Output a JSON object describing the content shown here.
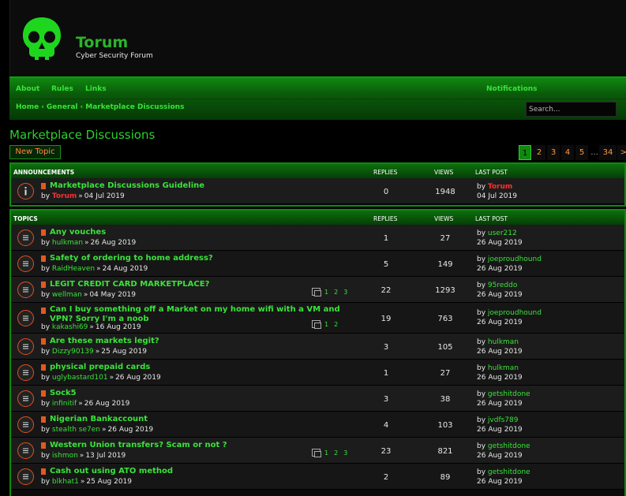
{
  "header": {
    "title": "Torum",
    "subtitle": "Cyber Security Forum"
  },
  "nav": {
    "about": "About",
    "rules": "Rules",
    "links": "Links",
    "notifications": "Notifications"
  },
  "breadcrumbs": [
    "Home",
    "General",
    "Marketplace Discussions"
  ],
  "search": {
    "placeholder": "Search..."
  },
  "page_title": "Marketplace Discussions",
  "new_topic_label": "New Topic",
  "pagination": {
    "pages": [
      "1",
      "2",
      "3",
      "4",
      "5",
      "...",
      "34",
      ">"
    ],
    "current": "1"
  },
  "announcements": {
    "headers": {
      "section": "ANNOUNCEMENTS",
      "replies": "REPLIES",
      "views": "VIEWS",
      "last_post": "LAST POST"
    },
    "rows": [
      {
        "title": "Marketplace Discussions Guideline",
        "by": "by",
        "author": "Torum",
        "date": "04 Jul 2019",
        "replies": "0",
        "views": "1948",
        "last_user": "Torum",
        "last_date": "04 Jul 2019"
      }
    ]
  },
  "topics": {
    "headers": {
      "section": "TOPICS",
      "replies": "REPLIES",
      "views": "VIEWS",
      "last_post": "LAST POST"
    },
    "rows": [
      {
        "title": "Any vouches",
        "author": "hulkman",
        "date": "26 Aug 2019",
        "replies": "1",
        "views": "27",
        "last_user": "user212",
        "last_date": "26 Aug 2019"
      },
      {
        "title": "Safety of ordering to home address?",
        "author": "RaidHeaven",
        "date": "24 Aug 2019",
        "replies": "5",
        "views": "149",
        "last_user": "joeproudhound",
        "last_date": "26 Aug 2019"
      },
      {
        "title": "LEGIT CREDIT CARD MARKETPLACE?",
        "author": "wellman",
        "date": "04 May 2019",
        "replies": "22",
        "views": "1293",
        "last_user": "95reddo",
        "last_date": "26 Aug 2019",
        "pages": [
          "1",
          "2",
          "3"
        ]
      },
      {
        "title": "Can I buy something off a Market on my home wifi with a VM and VPN? Sorry I'm a noob",
        "author": "kakashi69",
        "date": "16 Aug 2019",
        "replies": "19",
        "views": "763",
        "last_user": "joeproudhound",
        "last_date": "26 Aug 2019",
        "pages": [
          "1",
          "2"
        ]
      },
      {
        "title": "Are these markets legit?",
        "author": "Dizzy90139",
        "date": "25 Aug 2019",
        "replies": "3",
        "views": "105",
        "last_user": "hulkman",
        "last_date": "26 Aug 2019"
      },
      {
        "title": "physical prepaid cards",
        "author": "uglybastard101",
        "date": "26 Aug 2019",
        "replies": "1",
        "views": "27",
        "last_user": "hulkman",
        "last_date": "26 Aug 2019"
      },
      {
        "title": "Sock5",
        "author": "infinitif",
        "date": "26 Aug 2019",
        "replies": "3",
        "views": "38",
        "last_user": "getshitdone",
        "last_date": "26 Aug 2019"
      },
      {
        "title": "Nigerian Bankaccount",
        "author": "stealth se7en",
        "date": "26 Aug 2019",
        "replies": "4",
        "views": "103",
        "last_user": "jvdfs789",
        "last_date": "26 Aug 2019"
      },
      {
        "title": "Western Union transfers? Scam or not ?",
        "author": "ishmon",
        "date": "13 Jul 2019",
        "replies": "23",
        "views": "821",
        "last_user": "getshitdone",
        "last_date": "26 Aug 2019",
        "pages": [
          "1",
          "2",
          "3"
        ]
      },
      {
        "title": "Cash out using ATO method",
        "author": "blkhat1",
        "date": "25 Aug 2019",
        "replies": "2",
        "views": "89",
        "last_user": "getshitdone",
        "last_date": "26 Aug 2019"
      }
    ]
  },
  "colors": {
    "accent": "#39e339",
    "nav_green": "#0f8a0f",
    "orange": "#ff8c3a",
    "red_user": "#ff3030"
  },
  "icons": {
    "logo": "skull-icon",
    "topic": "topic-bubble-icon",
    "announcement": "info-bubble-icon",
    "pages": "multipage-icon"
  }
}
